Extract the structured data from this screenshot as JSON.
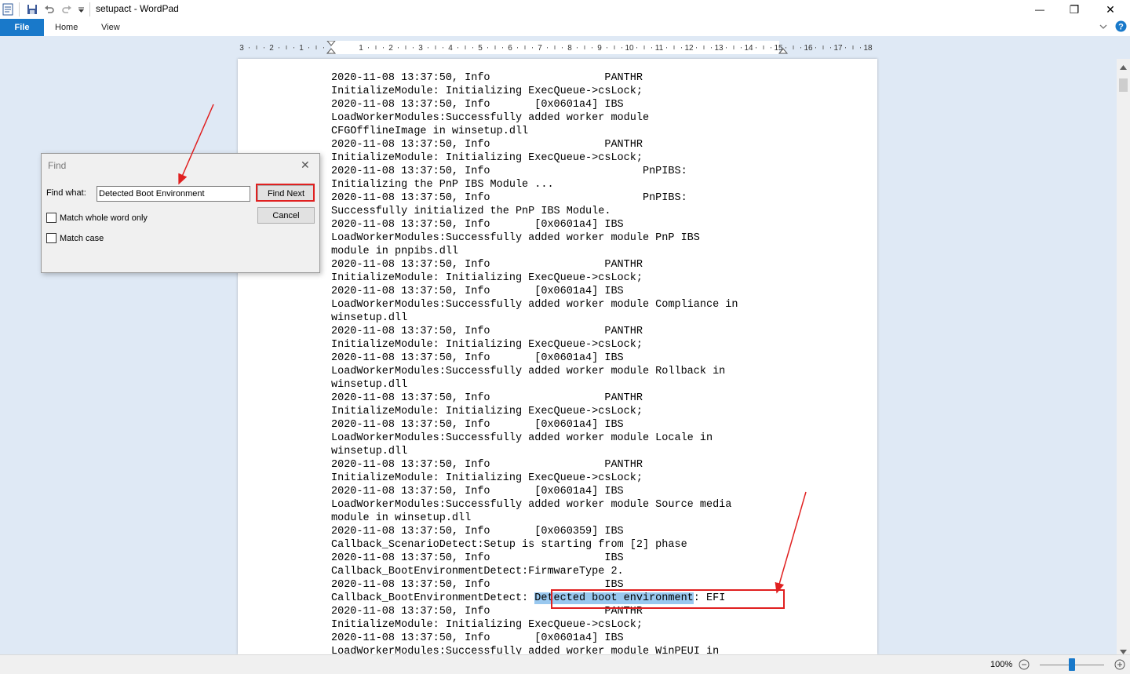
{
  "window": {
    "title": "setupact - WordPad",
    "controls": {
      "minimize": "—",
      "restore": "❐",
      "close": "✕"
    }
  },
  "ribbon": {
    "tabs": [
      "File",
      "Home",
      "View"
    ]
  },
  "ruler": {
    "labels": [
      "3",
      "2",
      "1",
      "1",
      "2",
      "3",
      "4",
      "5",
      "6",
      "7",
      "8",
      "9",
      "10",
      "11",
      "12",
      "13",
      "14",
      "15",
      "16",
      "17",
      "18"
    ]
  },
  "document": {
    "lines": [
      "2020-11-08 13:37:50, Info                  PANTHR",
      "InitializeModule: Initializing ExecQueue->csLock;",
      "2020-11-08 13:37:50, Info       [0x0601a4] IBS",
      "LoadWorkerModules:Successfully added worker module",
      "CFGOfflineImage in winsetup.dll",
      "2020-11-08 13:37:50, Info                  PANTHR",
      "InitializeModule: Initializing ExecQueue->csLock;",
      "2020-11-08 13:37:50, Info                        PnPIBS:",
      "Initializing the PnP IBS Module ...",
      "2020-11-08 13:37:50, Info                        PnPIBS:",
      "Successfully initialized the PnP IBS Module.",
      "2020-11-08 13:37:50, Info       [0x0601a4] IBS",
      "LoadWorkerModules:Successfully added worker module PnP IBS",
      "module in pnpibs.dll",
      "2020-11-08 13:37:50, Info                  PANTHR",
      "InitializeModule: Initializing ExecQueue->csLock;",
      "2020-11-08 13:37:50, Info       [0x0601a4] IBS",
      "LoadWorkerModules:Successfully added worker module Compliance in",
      "winsetup.dll",
      "2020-11-08 13:37:50, Info                  PANTHR",
      "InitializeModule: Initializing ExecQueue->csLock;",
      "2020-11-08 13:37:50, Info       [0x0601a4] IBS",
      "LoadWorkerModules:Successfully added worker module Rollback in",
      "winsetup.dll",
      "2020-11-08 13:37:50, Info                  PANTHR",
      "InitializeModule: Initializing ExecQueue->csLock;",
      "2020-11-08 13:37:50, Info       [0x0601a4] IBS",
      "LoadWorkerModules:Successfully added worker module Locale in",
      "winsetup.dll",
      "2020-11-08 13:37:50, Info                  PANTHR",
      "InitializeModule: Initializing ExecQueue->csLock;",
      "2020-11-08 13:37:50, Info       [0x0601a4] IBS",
      "LoadWorkerModules:Successfully added worker module Source media",
      "module in winsetup.dll",
      "2020-11-08 13:37:50, Info       [0x060359] IBS",
      "Callback_ScenarioDetect:Setup is starting from [2] phase",
      "2020-11-08 13:37:50, Info                  IBS",
      "Callback_BootEnvironmentDetect:FirmwareType 2.",
      "2020-11-08 13:37:50, Info                  IBS",
      "__HIGHLIGHT__",
      "2020-11-08 13:37:50, Info                  PANTHR",
      "InitializeModule: Initializing ExecQueue->csLock;",
      "2020-11-08 13:37:50, Info       [0x0601a4] IBS",
      "LoadWorkerModules:Successfully added worker module WinPEUI in"
    ],
    "highlight_line": {
      "before": "Callback_BootEnvironmentDetect: ",
      "match": "Detected boot environment",
      "after": ": EFI"
    }
  },
  "find_dialog": {
    "title": "Find",
    "find_what_label": "Find what:",
    "find_what_value": "Detected Boot Environment",
    "find_next_label": "Find Next",
    "cancel_label": "Cancel",
    "match_whole_word_label": "Match whole word only",
    "match_case_label": "Match case"
  },
  "status": {
    "zoom": "100%",
    "zoom_level_percent": 100
  },
  "colors": {
    "accent": "#1979ca",
    "annotation": "#e02020",
    "selection": "#99c8ef",
    "workspace": "#dfe9f5"
  }
}
